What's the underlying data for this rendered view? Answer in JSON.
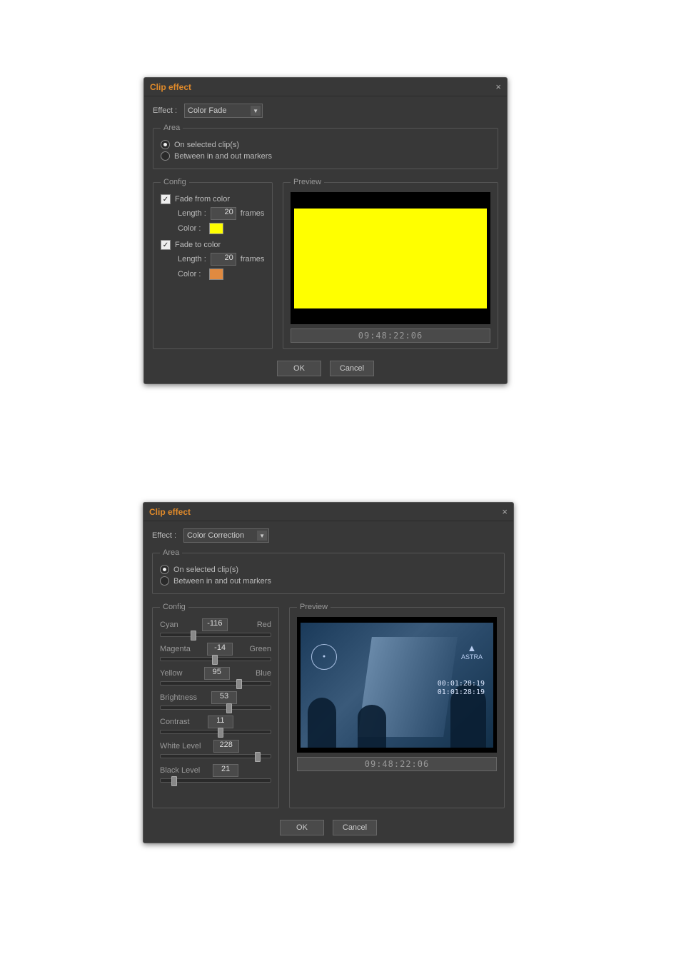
{
  "dialogA": {
    "title": "Clip effect",
    "effect_label": "Effect :",
    "effect_value": "Color Fade",
    "area": {
      "legend": "Area",
      "opt_selected": "On selected clip(s)",
      "opt_markers": "Between in and out markers"
    },
    "config": {
      "legend": "Config",
      "fade_from_label": "Fade from color",
      "fade_to_label": "Fade to color",
      "length_label": "Length :",
      "frames_label": "frames",
      "color_label": "Color :",
      "from_length": "20",
      "to_length": "20",
      "from_color": "#ffff00",
      "to_color": "#e08a40"
    },
    "preview_legend": "Preview",
    "timecode": "09:48:22:06",
    "ok": "OK",
    "cancel": "Cancel"
  },
  "dialogB": {
    "title": "Clip effect",
    "effect_label": "Effect :",
    "effect_value": "Color Correction",
    "area": {
      "legend": "Area",
      "opt_selected": "On selected clip(s)",
      "opt_markers": "Between in and out markers"
    },
    "config": {
      "legend": "Config",
      "sliders": [
        {
          "left": "Cyan",
          "value": "-116",
          "right": "Red",
          "pos": 27
        },
        {
          "left": "Magenta",
          "value": "-14",
          "right": "Green",
          "pos": 47
        },
        {
          "left": "Yellow",
          "value": "95",
          "right": "Blue",
          "pos": 69
        },
        {
          "left": "Brightness",
          "value": "53",
          "right": "",
          "pos": 60
        },
        {
          "left": "Contrast",
          "value": "11",
          "right": "",
          "pos": 52
        },
        {
          "left": "White Level",
          "value": "228",
          "right": "",
          "pos": 86
        },
        {
          "left": "Black Level",
          "value": "21",
          "right": "",
          "pos": 10
        }
      ]
    },
    "preview_legend": "Preview",
    "preview_overlay": {
      "logo_right": "ASTRA",
      "tc1": "00:01:28:19",
      "tc2": "01:01:28:19"
    },
    "timecode": "09:48:22:06",
    "ok": "OK",
    "cancel": "Cancel"
  }
}
